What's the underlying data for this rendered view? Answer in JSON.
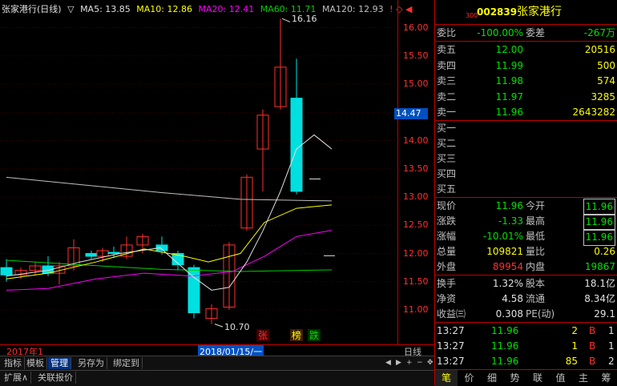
{
  "legend": {
    "name": "张家港行(日线)",
    "ma5": "MA5: 13.85",
    "ma10": "MA10: 12.86",
    "ma20": "MA20: 12.41",
    "ma60": "MA60: 11.71",
    "ma120": "MA120: 12.93",
    "icons": "! ◇ ◀"
  },
  "colors": {
    "up": "#ff3030",
    "down": "#00e0e0",
    "ma5": "#e0e0e0",
    "ma10": "#ffff00",
    "ma20": "#ff00ff",
    "ma60": "#00d000",
    "ma120": "#c0c0c0"
  },
  "axis": {
    "ticks": [
      "16.00",
      "15.50",
      "15.00",
      "14.50",
      "14.00",
      "13.50",
      "13.00",
      "12.50",
      "12.00",
      "11.50",
      "11.00"
    ],
    "current": "14.47",
    "high_label": "16.16",
    "low_label": "10.70"
  },
  "dates": {
    "left": "2017年1",
    "cursor": "2018/01/15/一",
    "right": "日线"
  },
  "markers": [
    "张",
    "榜",
    "跌"
  ],
  "tabs": [
    "指标",
    "模板",
    "管理",
    "另存为",
    "绑定到"
  ],
  "tabs2": [
    "扩展∧",
    "关联报价"
  ],
  "panel": {
    "code": "002839",
    "name": "张家港行",
    "sup": "300",
    "weibi": {
      "label": "委比",
      "value": "-100.00%",
      "label2": "委差",
      "value2": "-267万"
    },
    "asks": [
      {
        "label": "卖五",
        "price": "12.00",
        "vol": "20516"
      },
      {
        "label": "卖四",
        "price": "11.99",
        "vol": "500"
      },
      {
        "label": "卖三",
        "price": "11.98",
        "vol": "574"
      },
      {
        "label": "卖二",
        "price": "11.97",
        "vol": "3285"
      },
      {
        "label": "卖一",
        "price": "11.96",
        "vol": "2643282"
      }
    ],
    "bids": [
      {
        "label": "买一"
      },
      {
        "label": "买二"
      },
      {
        "label": "买三"
      },
      {
        "label": "买四"
      },
      {
        "label": "买五"
      }
    ],
    "stats": [
      {
        "l1": "现价",
        "v1": "11.96",
        "l2": "今开",
        "v2": "11.96"
      },
      {
        "l1": "涨跌",
        "v1": "-1.33",
        "l2": "最高",
        "v2": "11.96"
      },
      {
        "l1": "涨幅",
        "v1": "-10.01%",
        "l2": "最低",
        "v2": "11.96"
      },
      {
        "l1": "总量",
        "v1": "109821",
        "l2": "量比",
        "v2": "0.26"
      },
      {
        "l1": "外盘",
        "v1": "89954",
        "l2": "内盘",
        "v2": "19867"
      }
    ],
    "stats2": [
      {
        "l1": "换手",
        "v1": "1.32%",
        "l2": "股本",
        "v2": "18.1亿"
      },
      {
        "l1": "净资",
        "v1": "4.58",
        "l2": "流通",
        "v2": "8.34亿"
      },
      {
        "l1": "收益㈢",
        "v1": "0.308",
        "l2": "PE(动)",
        "v2": "29.1"
      }
    ],
    "trades": [
      {
        "time": "13:27",
        "price": "11.96",
        "vol": "2",
        "side": "B",
        "n": "1"
      },
      {
        "time": "13:27",
        "price": "11.96",
        "vol": "1",
        "side": "B",
        "n": "1"
      },
      {
        "time": "13:27",
        "price": "11.96",
        "vol": "85",
        "side": "B",
        "n": "2"
      }
    ],
    "tabs": [
      "笔",
      "价",
      "细",
      "势",
      "联",
      "值",
      "主",
      "筹"
    ]
  }
}
